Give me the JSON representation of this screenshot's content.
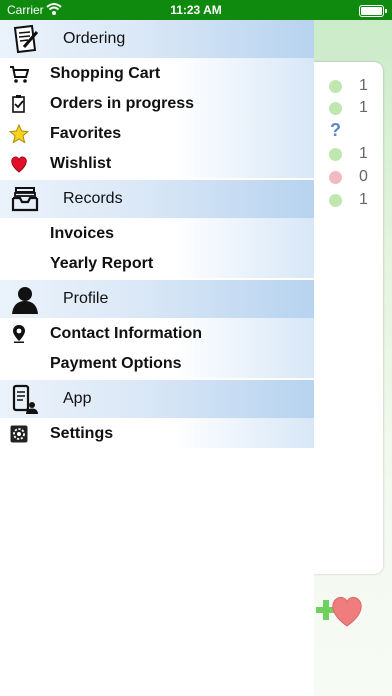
{
  "status_bar": {
    "carrier": "Carrier",
    "time": "11:23 AM"
  },
  "background": {
    "rows": [
      {
        "status": "green",
        "value": "1"
      },
      {
        "status": "green",
        "value": "1"
      },
      {
        "status": "unknown",
        "value": "?"
      },
      {
        "status": "green",
        "value": "1"
      },
      {
        "status": "red",
        "value": "0"
      },
      {
        "status": "green",
        "value": "1"
      }
    ]
  },
  "menu": {
    "sections": [
      {
        "label": "Ordering",
        "icon": "document-pen-icon",
        "items": [
          {
            "label": "Shopping Cart",
            "icon": "cart-icon"
          },
          {
            "label": "Orders in progress",
            "icon": "clipboard-check-icon"
          },
          {
            "label": "Favorites",
            "icon": "star-icon"
          },
          {
            "label": "Wishlist",
            "icon": "heart-icon"
          }
        ]
      },
      {
        "label": "Records",
        "icon": "inbox-tray-icon",
        "items": [
          {
            "label": "Invoices"
          },
          {
            "label": "Yearly Report"
          }
        ]
      },
      {
        "label": "Profile",
        "icon": "person-icon",
        "items": [
          {
            "label": "Contact Information",
            "icon": "location-pin-icon"
          },
          {
            "label": "Payment Options"
          }
        ]
      },
      {
        "label": "App",
        "icon": "phone-person-icon",
        "items": [
          {
            "label": "Settings",
            "icon": "gear-icon"
          }
        ]
      }
    ]
  },
  "colors": {
    "status_bar": "#0f8a0f",
    "dot_green": "#bfe8b0",
    "dot_red": "#f3b9c3",
    "section_accent": "#b7d3ef"
  }
}
